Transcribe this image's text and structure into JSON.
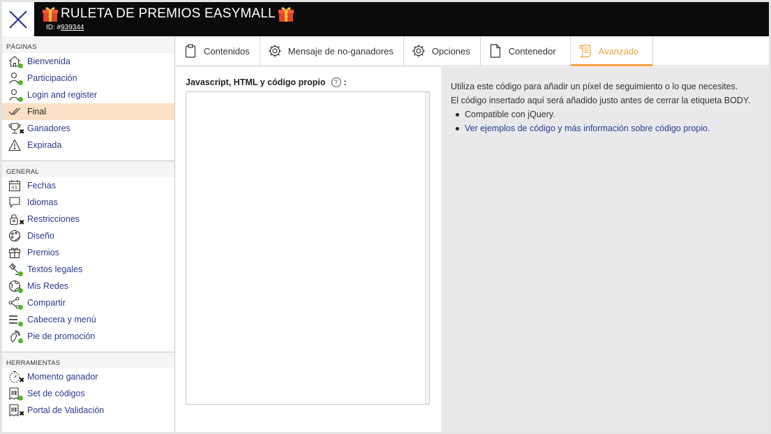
{
  "app": {
    "title": "RULETA DE PREMIOS EASYMALL",
    "id_prefix": "ID: #",
    "id_value": "939344"
  },
  "colors": {
    "header_bg": "#0b0b0b",
    "close_icon": "#2d3a8e",
    "link": "#2d3a8e",
    "active_tab": "#f2a03a",
    "active_nav_bg": "#fbe0c8",
    "status_green": "#52b52c",
    "info_panel_bg": "#e9e9ec"
  },
  "sidebar": {
    "sections": [
      {
        "title": "PÁGINAS",
        "items": [
          {
            "label": "Bienvenida",
            "icon": "home-icon",
            "status": "green"
          },
          {
            "label": "Participación",
            "icon": "user-edit-icon",
            "status": "green"
          },
          {
            "label": "Login and register",
            "icon": "user-edit-icon",
            "status": "green"
          },
          {
            "label": "Final",
            "icon": "double-check-icon",
            "status": "none",
            "active": true
          },
          {
            "label": "Ganadores",
            "icon": "trophy-icon",
            "status": "x"
          },
          {
            "label": "Expirada",
            "icon": "warning-icon",
            "status": "none"
          }
        ]
      },
      {
        "title": "GENERAL",
        "items": [
          {
            "label": "Fechas",
            "icon": "calendar-icon",
            "status": "none"
          },
          {
            "label": "Idiomas",
            "icon": "speech-bubble-icon",
            "status": "none"
          },
          {
            "label": "Restricciones",
            "icon": "lock-icon",
            "status": "x"
          },
          {
            "label": "Diseño",
            "icon": "palette-icon",
            "status": "none"
          },
          {
            "label": "Premios",
            "icon": "gift-icon",
            "status": "none"
          },
          {
            "label": "Textos legales",
            "icon": "gavel-icon",
            "status": "green"
          },
          {
            "label": "Mis Redes",
            "icon": "globe-icon",
            "status": "green"
          },
          {
            "label": "Compartir",
            "icon": "share-icon",
            "status": "green"
          },
          {
            "label": "Cabecera y menú",
            "icon": "menu-icon",
            "status": "green"
          },
          {
            "label": "Pie de promoción",
            "icon": "footprint-icon",
            "status": "green"
          }
        ]
      },
      {
        "title": "HERRAMIENTAS",
        "items": [
          {
            "label": "Momento ganador",
            "icon": "stopwatch-icon",
            "status": "x"
          },
          {
            "label": "Set de códigos",
            "icon": "code-ticket-icon",
            "status": "green"
          },
          {
            "label": "Portal de Validación",
            "icon": "code-ticket-icon",
            "status": "x"
          }
        ]
      }
    ]
  },
  "tabs": [
    {
      "label": "Contenidos",
      "icon": "clipboard-icon",
      "active": false
    },
    {
      "label": "Mensaje de no-ganadores",
      "icon": "gear-icon",
      "active": false
    },
    {
      "label": "Opciones",
      "icon": "gear-icon",
      "active": false
    },
    {
      "label": "Contenedor",
      "icon": "document-icon",
      "active": false
    },
    {
      "label": "Avanzado",
      "icon": "scroll-icon",
      "active": true
    }
  ],
  "editor": {
    "label": "Javascript, HTML y código propio",
    "label_suffix": ":",
    "help": "?",
    "value": ""
  },
  "info": {
    "line1": "Utiliza este código para añadir un píxel de seguimiento o lo que necesites.",
    "line2": "El código insertado aquí será añadido justo antes de cerrar la etiqueta BODY.",
    "bullets": [
      {
        "text": "Compatible con jQuery.",
        "link": false
      },
      {
        "text": "Ver ejemplos de código y más información sobre código propio.",
        "link": true
      }
    ]
  }
}
